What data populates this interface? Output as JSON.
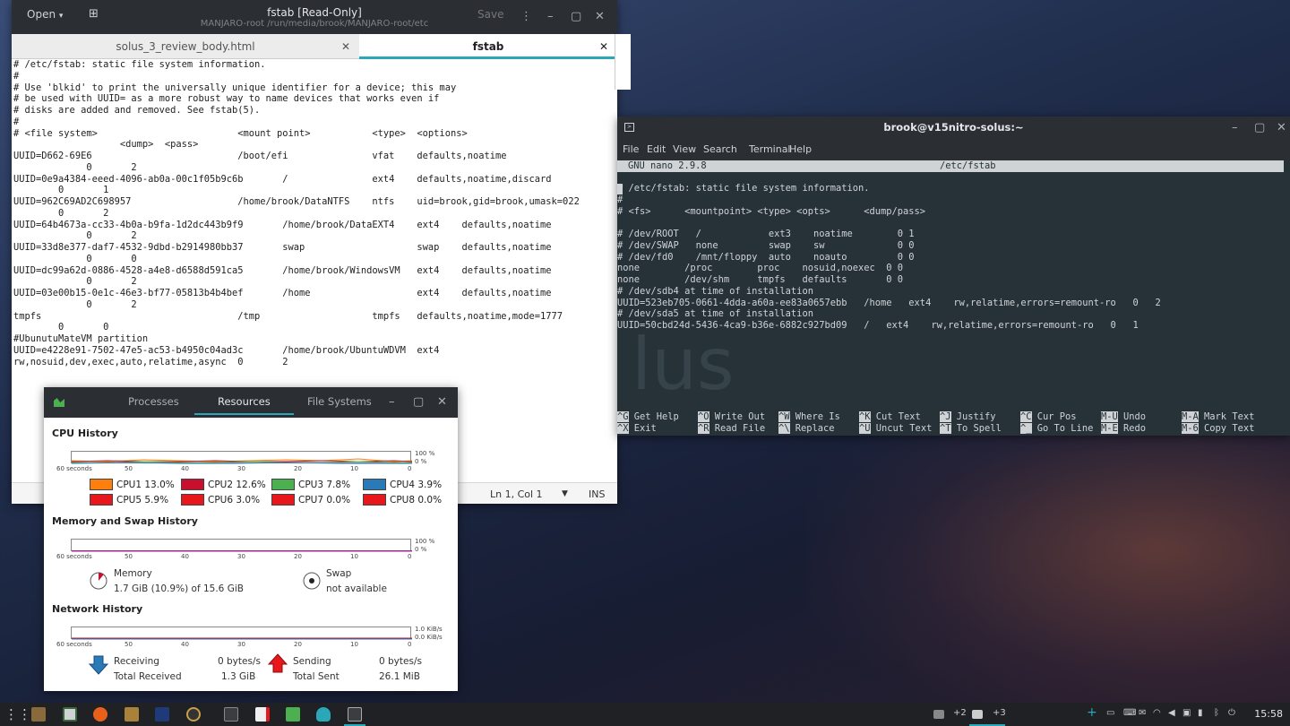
{
  "gedit": {
    "open_label": "Open",
    "save_label": "Save",
    "title": "fstab [Read-Only]",
    "subtitle": "MANJARO-root /run/media/brook/MANJARO-root/etc",
    "tabs": [
      {
        "label": "solus_3_review_body.html"
      },
      {
        "label": "fstab"
      }
    ],
    "lines": [
      "# /etc/fstab: static file system information.",
      "#",
      "# Use 'blkid' to print the universally unique identifier for a device; this may",
      "# be used with UUID= as a more robust way to name devices that works even if",
      "# disks are added and removed. See fstab(5).",
      "#",
      "# <file system>                         <mount point>           <type>  <options>",
      "                   <dump>  <pass>",
      "UUID=D662-69E6                          /boot/efi               vfat    defaults,noatime",
      "             0       2",
      "UUID=0e9a4384-eeed-4096-ab0a-00c1f05b9c6b       /               ext4    defaults,noatime,discard",
      "        0       1",
      "UUID=962C69AD2C698957                   /home/brook/DataNTFS    ntfs    uid=brook,gid=brook,umask=022",
      "        0       2",
      "UUID=64b4673a-cc33-4b0a-b9fa-1d2dc443b9f9       /home/brook/DataEXT4    ext4    defaults,noatime",
      "             0       2",
      "UUID=33d8e377-daf7-4532-9dbd-b2914980bb37       swap                    swap    defaults,noatime",
      "             0       0",
      "UUID=dc99a62d-0886-4528-a4e8-d6588d591ca5       /home/brook/WindowsVM   ext4    defaults,noatime",
      "             0       2",
      "UUID=03e00b15-0e1c-46e3-bf77-05813b4b4bef       /home                   ext4    defaults,noatime",
      "             0       2",
      "tmpfs                                   /tmp                    tmpfs   defaults,noatime,mode=1777",
      "        0       0",
      "#UbunutuMateVM partition",
      "UUID=e4228e91-7502-47e5-ac53-b4950c04ad3c       /home/brook/UbuntuWDVM  ext4",
      "rw,nosuid,dev,exec,auto,relatime,async  0       2"
    ],
    "status": {
      "position": "Ln 1, Col 1",
      "mode": "INS"
    }
  },
  "terminal": {
    "title": "brook@v15nitro-solus:~",
    "menu": [
      "File",
      "Edit",
      "View",
      "Search",
      "Terminal",
      "Help"
    ],
    "nano_version": "GNU nano 2.9.8",
    "nano_file": "/etc/fstab",
    "lines": [
      "# /etc/fstab: static file system information.",
      "#",
      "# <fs>      <mountpoint> <type> <opts>      <dump/pass>",
      "",
      "# /dev/ROOT   /            ext3    noatime        0 1",
      "# /dev/SWAP   none         swap    sw             0 0",
      "# /dev/fd0    /mnt/floppy  auto    noauto         0 0",
      "none        /proc        proc    nosuid,noexec  0 0",
      "none        /dev/shm     tmpfs   defaults       0 0",
      "# /dev/sdb4 at time of installation",
      "UUID=523eb705-0661-4dda-a60a-ee83a0657ebb   /home   ext4    rw,relatime,errors=remount-ro   0   2",
      "# /dev/sda5 at time of installation",
      "UUID=50cbd24d-5436-4ca9-b36e-6882c927bd09   /   ext4    rw,relatime,errors=remount-ro   0   1"
    ],
    "watermark": "lus",
    "shortcuts": [
      {
        "k1": "^G",
        "l1": "Get Help",
        "k2": "^X",
        "l2": "Exit"
      },
      {
        "k1": "^O",
        "l1": "Write Out",
        "k2": "^R",
        "l2": "Read File"
      },
      {
        "k1": "^W",
        "l1": "Where Is",
        "k2": "^\\",
        "l2": "Replace"
      },
      {
        "k1": "^K",
        "l1": "Cut Text",
        "k2": "^U",
        "l2": "Uncut Text"
      },
      {
        "k1": "^J",
        "l1": "Justify",
        "k2": "^T",
        "l2": "To Spell"
      },
      {
        "k1": "^C",
        "l1": "Cur Pos",
        "k2": "^_",
        "l2": "Go To Line"
      },
      {
        "k1": "M-U",
        "l1": "Undo",
        "k2": "M-E",
        "l2": "Redo"
      },
      {
        "k1": "M-A",
        "l1": "Mark Text",
        "k2": "M-6",
        "l2": "Copy Text"
      }
    ]
  },
  "monitor": {
    "tabs": [
      "Processes",
      "Resources",
      "File Systems"
    ],
    "cpu_title": "CPU History",
    "mem_title": "Memory and Swap History",
    "net_title": "Network History",
    "x_ticks": [
      "60 seconds",
      "50",
      "40",
      "30",
      "20",
      "10",
      "0"
    ],
    "pct_hi": "100 %",
    "pct_lo": "0 %",
    "net_hi": "1.0 KiB/s",
    "net_lo": "0.0 KiB/s",
    "cpus": [
      {
        "name": "CPU1",
        "value": "13.0%",
        "color": "#ff7f0e"
      },
      {
        "name": "CPU2",
        "value": "12.6%",
        "color": "#c8102e"
      },
      {
        "name": "CPU3",
        "value": "7.8%",
        "color": "#4caf50"
      },
      {
        "name": "CPU4",
        "value": "3.9%",
        "color": "#2a7ab8"
      },
      {
        "name": "CPU5",
        "value": "5.9%",
        "color": "#e8171c"
      },
      {
        "name": "CPU6",
        "value": "3.0%",
        "color": "#e8171c"
      },
      {
        "name": "CPU7",
        "value": "0.0%",
        "color": "#e8171c"
      },
      {
        "name": "CPU8",
        "value": "0.0%",
        "color": "#e8171c"
      }
    ],
    "memory": {
      "label": "Memory",
      "value": "1.7 GiB (10.9%) of 15.6 GiB",
      "fraction": 0.109
    },
    "swap": {
      "label": "Swap",
      "value": "not available"
    },
    "receiving": {
      "label": "Receiving",
      "rate": "0 bytes/s",
      "total_label": "Total Received",
      "total": "1.3 GiB"
    },
    "sending": {
      "label": "Sending",
      "rate": "0 bytes/s",
      "total_label": "Total Sent",
      "total": "26.1 MiB"
    }
  },
  "taskbar": {
    "tray_count_1": "+2",
    "tray_count_2": "+3",
    "clock": "15:58"
  }
}
